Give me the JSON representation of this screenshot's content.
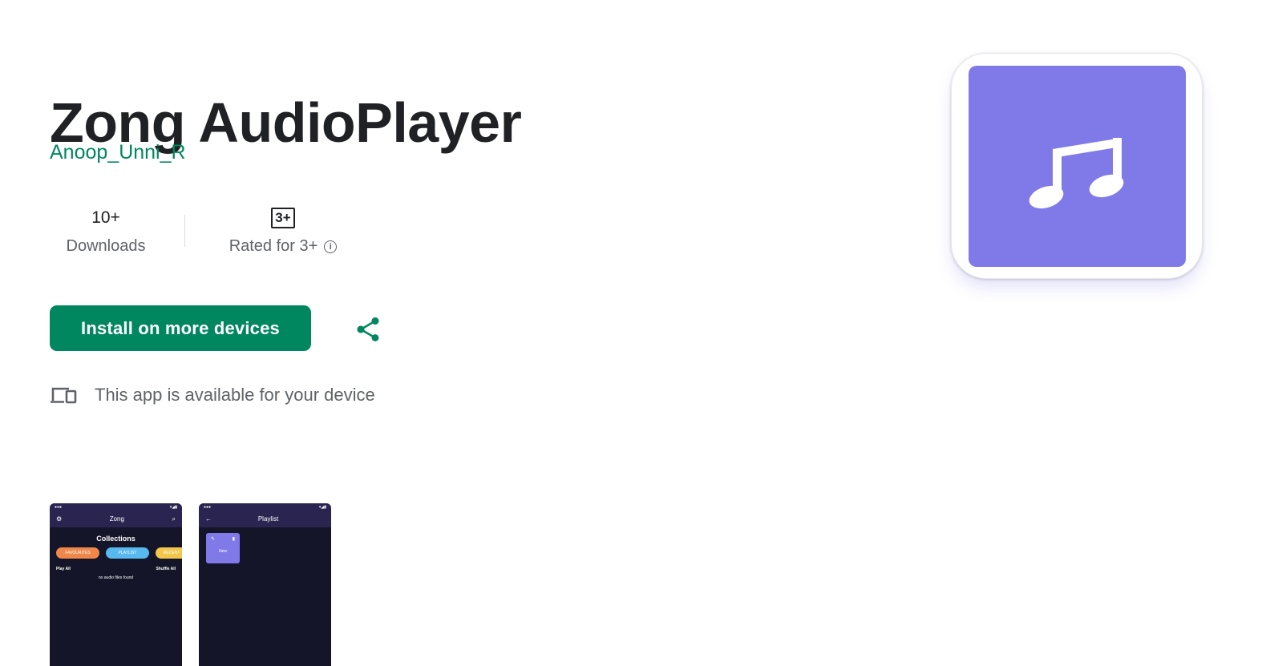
{
  "app": {
    "title": "Zong AudioPlayer",
    "developer": "Anoop_Unni_R",
    "icon": "music-note-icon",
    "icon_color": "#8079e8"
  },
  "stats": {
    "downloads_value": "10+",
    "downloads_label": "Downloads",
    "rating_badge": "3+",
    "rating_label": "Rated for 3+"
  },
  "actions": {
    "install_label": "Install on more devices",
    "share_icon": "share-icon",
    "accent_color": "#01875f"
  },
  "availability": {
    "icon": "devices-icon",
    "text": "This app is available for your device"
  },
  "screenshots": [
    {
      "app_title": "Zong",
      "heading": "Collections",
      "pills": [
        "FAVOURITES",
        "PLAYLIST",
        "RECENT"
      ],
      "play_all": "Play All",
      "shuffle_all": "Shuffle All",
      "empty_message": "no audio files found"
    },
    {
      "app_title": "Playlist",
      "card_label": "New"
    }
  ]
}
